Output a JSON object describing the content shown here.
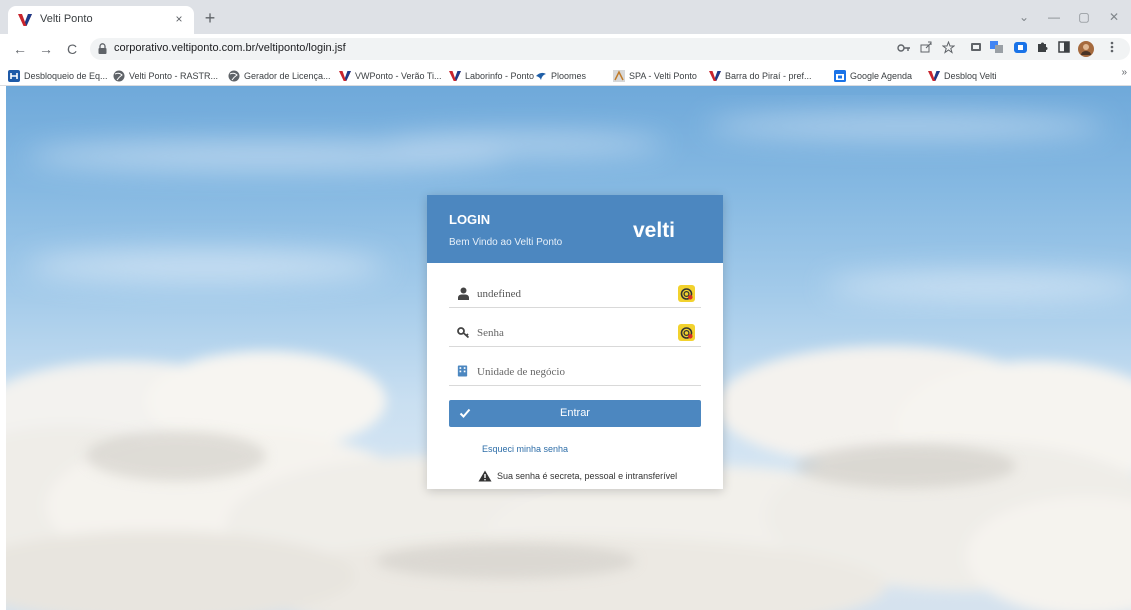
{
  "browser": {
    "tab": {
      "title": "Velti Ponto",
      "close": "×"
    },
    "new_tab": "+",
    "window_controls": {
      "chevron": "⌄",
      "minimize": "—",
      "restore": "▢",
      "close": "✕"
    },
    "nav": {
      "back": "←",
      "forward": "→",
      "reload": "C"
    },
    "url": "corporativo.veltiponto.com.br/veltiponto/login.jsf",
    "toolbar_icons": [
      "key-icon",
      "share-icon",
      "star-icon",
      "cast-icon",
      "translate-icon",
      "extension-icon",
      "puzzle-icon",
      "sidepanel-icon",
      "avatar",
      "menu-icon"
    ],
    "bookmarks": [
      {
        "label": "Desbloqueio de Eq...",
        "icon": "blue-square-icon"
      },
      {
        "label": "Velti Ponto - RASTR...",
        "icon": "globe-icon"
      },
      {
        "label": "Gerador de Licença...",
        "icon": "globe-icon"
      },
      {
        "label": "VWPonto - Verão Ti...",
        "icon": "velti-icon"
      },
      {
        "label": "Laborinfo - Ponto",
        "icon": "velti-icon"
      },
      {
        "label": "Ploomes",
        "icon": "ploomes-icon"
      },
      {
        "label": "SPA - Velti Ponto",
        "icon": "spa-icon"
      },
      {
        "label": "Barra do Piraí - pref...",
        "icon": "velti-icon"
      },
      {
        "label": "Google Agenda",
        "icon": "calendar-icon"
      },
      {
        "label": "Desbloq Velti",
        "icon": "velti-icon"
      }
    ],
    "bookmarks_more": "»"
  },
  "login": {
    "title": "LOGIN",
    "subtitle": "Bem Vindo ao Velti Ponto",
    "logo": "velti",
    "username_value": "undefined",
    "password_placeholder": "Senha",
    "unit_placeholder": "Unidade de negócio",
    "enter_label": "Entrar",
    "forgot_label": "Esqueci minha senha",
    "warning": "Sua senha é secreta, pessoal e intransferível"
  },
  "colors": {
    "accent": "#4c87c0",
    "link": "#2e6ea8",
    "velti_red": "#c8242c",
    "velti_navy": "#1b3c8a"
  }
}
